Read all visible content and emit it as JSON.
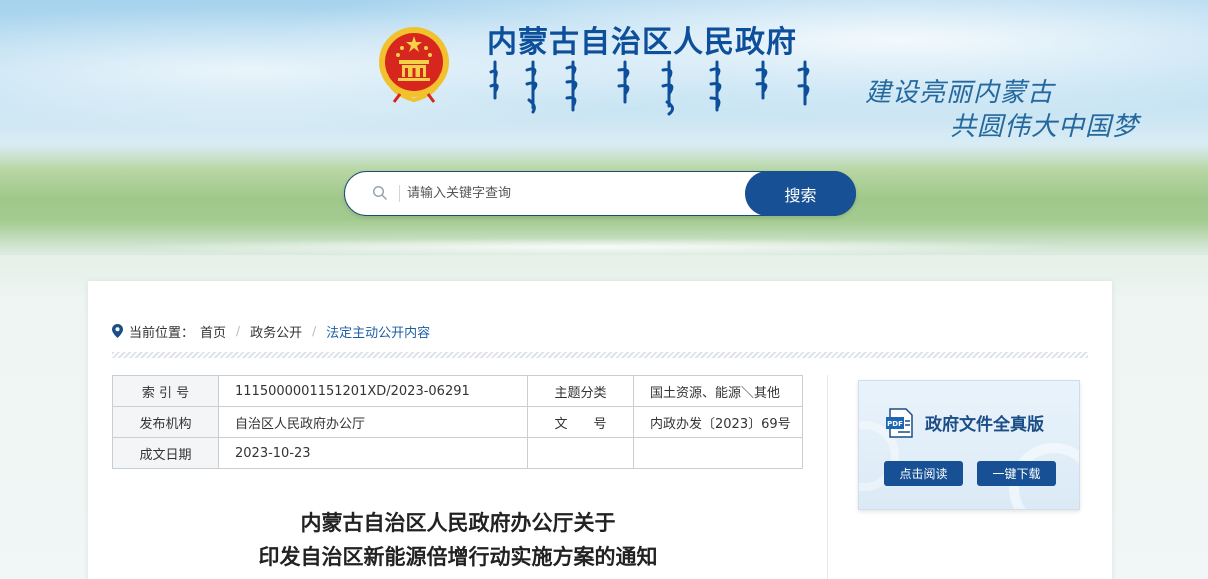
{
  "header": {
    "site_title": "内蒙古自治区人民政府",
    "slogan_line1": "建设亮丽内蒙古",
    "slogan_line2": "共圆伟大中国梦"
  },
  "search": {
    "placeholder": "请输入关键字查询",
    "button_label": "搜索"
  },
  "breadcrumb": {
    "label": "当前位置：",
    "items": [
      "首页",
      "政务公开",
      "法定主动公开内容"
    ]
  },
  "meta": {
    "index_label": "索 引 号",
    "index_value": "1115000001151201XD/2023-06291",
    "topic_label": "主题分类",
    "topic_value": "国土资源、能源＼其他",
    "publisher_label": "发布机构",
    "publisher_value": "自治区人民政府办公厅",
    "docno_label": "文　　号",
    "docno_value": "内政办发〔2023〕69号",
    "date_label": "成文日期",
    "date_value": "2023-10-23"
  },
  "doc_box": {
    "title": "政府文件全真版",
    "read_button": "点击阅读",
    "download_button": "一键下载"
  },
  "document": {
    "title_line1": "内蒙古自治区人民政府办公厅关于",
    "title_line2": "印发自治区新能源倍增行动实施方案的通知"
  },
  "colors": {
    "brand_blue": "#175094",
    "title_blue": "#0e4f9c",
    "link_blue": "#1d5ea8"
  }
}
